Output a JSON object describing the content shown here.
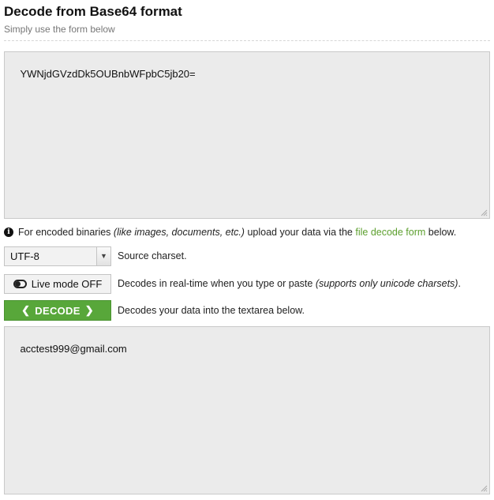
{
  "header": {
    "title": "Decode from Base64 format",
    "subtitle": "Simply use the form below"
  },
  "input": {
    "value": "YWNjdGVzdDk5OUBnbWFpbC5jb20="
  },
  "info": {
    "prefix": "For encoded binaries ",
    "italic": "(like images, documents, etc.)",
    "middle": " upload your data via the ",
    "link_text": "file decode form",
    "suffix": " below."
  },
  "charset": {
    "selected": "UTF-8",
    "description": "Source charset."
  },
  "live_mode": {
    "label": "Live mode OFF",
    "description": "Decodes in real-time when you type or paste ",
    "description_italic": "(supports only unicode charsets)",
    "description_end": "."
  },
  "decode": {
    "label": "DECODE",
    "description": "Decodes your data into the textarea below."
  },
  "output": {
    "value": "acctest999@gmail.com"
  },
  "colors": {
    "accent_green": "#58a73a",
    "link_green": "#5c9f2e",
    "textarea_bg": "#ebebeb"
  }
}
